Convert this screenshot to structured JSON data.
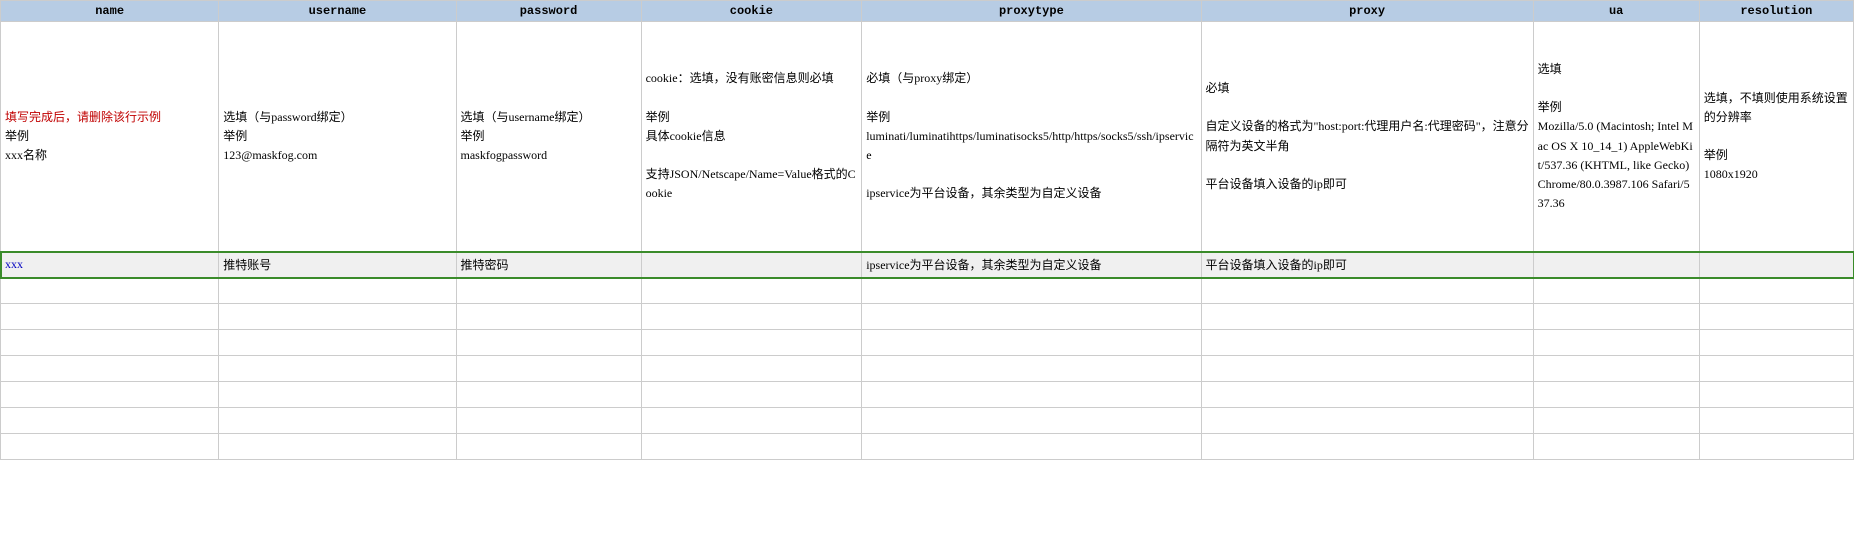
{
  "headers": {
    "name": "name",
    "username": "username",
    "password": "password",
    "cookie": "cookie",
    "proxytype": "proxytype",
    "proxy": "proxy",
    "ua": "ua",
    "resolution": "resolution"
  },
  "desc": {
    "name_red": "填写完成后，请删除该行示例",
    "name_l2": "举例",
    "name_l3": "xxx名称",
    "username_l1": "选填（与password绑定）",
    "username_l2": "举例",
    "username_l3": "123@maskfog.com",
    "password_l1": "选填（与username绑定）",
    "password_l2": "举例",
    "password_l3": "maskfogpassword",
    "cookie_l1": "cookie：选填，没有账密信息则必填",
    "cookie_l2": "举例",
    "cookie_l3": "具体cookie信息",
    "cookie_l4": "支持JSON/Netscape/Name=Value格式的Cookie",
    "proxytype_l1": "必填（与proxy绑定）",
    "proxytype_l2": "举例",
    "proxytype_l3": "luminati/luminatihttps/luminatisocks5/http/https/socks5/ssh/ipservice",
    "proxytype_l4": "ipservice为平台设备，其余类型为自定义设备",
    "proxy_l1": "必填",
    "proxy_l2": "自定义设备的格式为\"host:port:代理用户名:代理密码\"，注意分隔符为英文半角",
    "proxy_l3": "平台设备填入设备的ip即可",
    "ua_l1": "选填",
    "ua_l2": "举例",
    "ua_l3": "Mozilla/5.0 (Macintosh; Intel Mac OS X 10_14_1) AppleWebKit/537.36 (KHTML, like Gecko) Chrome/80.0.3987.106 Safari/537.36",
    "res_l1": "选填，不填则使用系统设置的分辨率",
    "res_l2": "举例",
    "res_l3": "1080x1920"
  },
  "row2": {
    "name": "xxx",
    "username": "推特账号",
    "password": "推特密码",
    "cookie": "",
    "proxytype": "ipservice为平台设备，其余类型为自定义设备",
    "proxy": "平台设备填入设备的ip即可",
    "ua": "",
    "resolution": ""
  }
}
